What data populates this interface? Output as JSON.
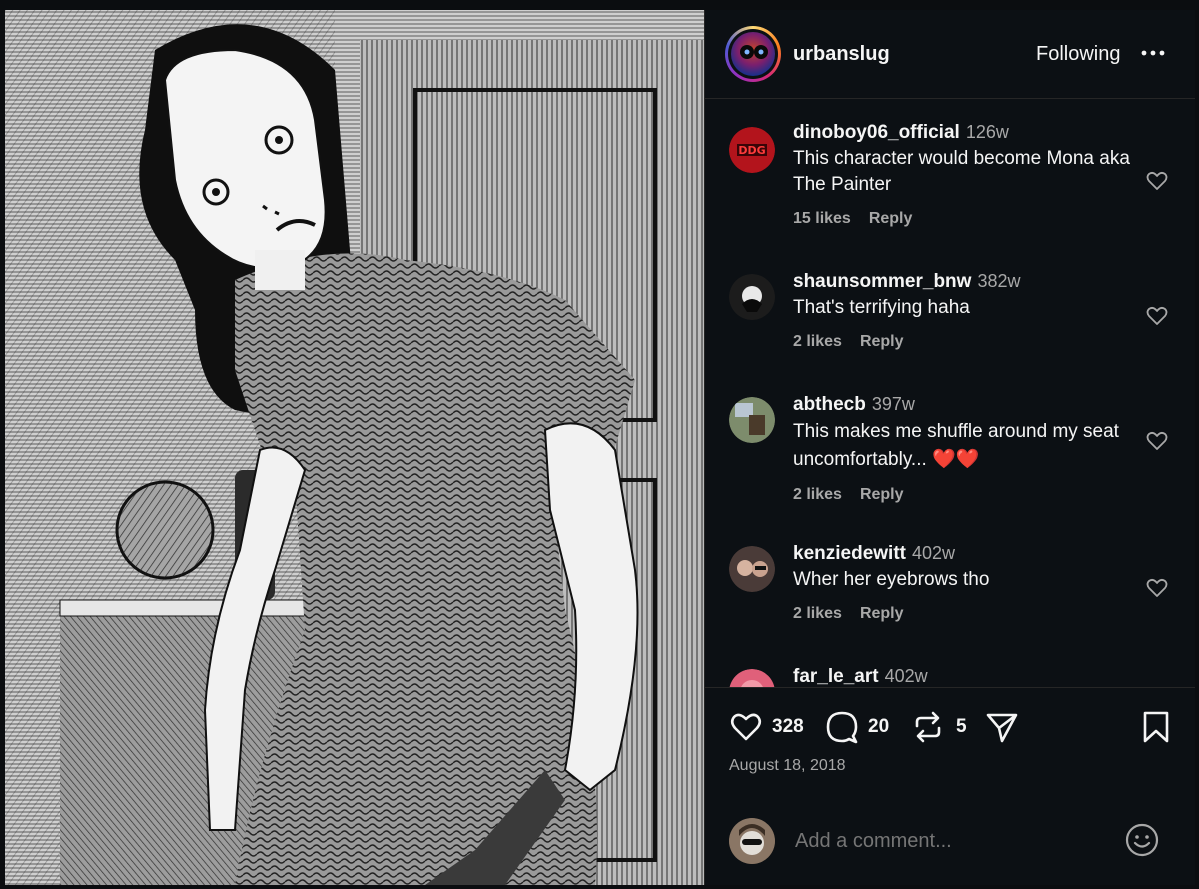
{
  "post": {
    "username": "urbanslug",
    "follow_label": "Following",
    "more_label": "•••"
  },
  "comments": [
    {
      "user": "dinoboy06_official",
      "time": "126w",
      "text": "This character would become Mona aka The Painter",
      "likes": "15 likes",
      "reply": "Reply",
      "avatar_color": "#b3141c"
    },
    {
      "user": "shaunsommer_bnw",
      "time": "382w",
      "text": "That's terrifying haha",
      "likes": "2 likes",
      "reply": "Reply",
      "avatar_color": "#2a2a2a"
    },
    {
      "user": "abthecb",
      "time": "397w",
      "text": "This makes me shuffle around my seat uncomfortably... ❤️❤️",
      "likes": "2 likes",
      "reply": "Reply",
      "avatar_color": "#8a9a7a"
    },
    {
      "user": "kenziedewitt",
      "time": "402w",
      "text": "Wher her eyebrows tho",
      "likes": "2 likes",
      "reply": "Reply",
      "avatar_color": "#5a4a48"
    },
    {
      "user": "far_le_art",
      "time": "402w",
      "avatar_color": "#e0607a"
    }
  ],
  "actions": {
    "like_count": "328",
    "comment_count": "20",
    "repost_count": "5"
  },
  "date": "August 18, 2018",
  "composer": {
    "placeholder": "Add a comment..."
  },
  "colors": {
    "background": "#0c1014",
    "muted_text": "#a8a8a8",
    "divider": "#262626",
    "heart_emoji": "#ff3d7f"
  }
}
